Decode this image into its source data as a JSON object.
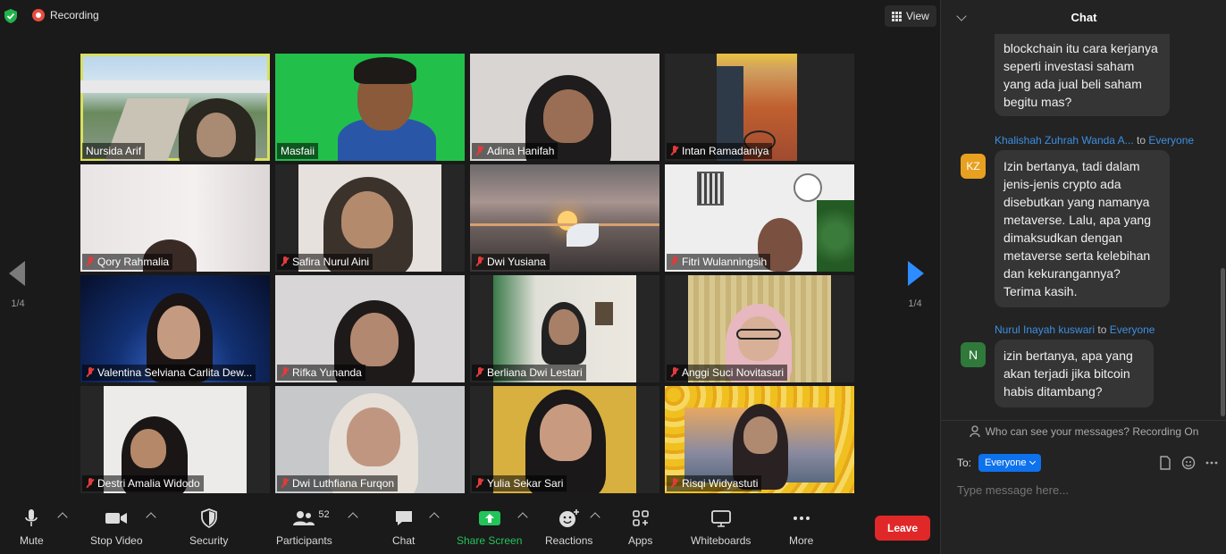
{
  "topbar": {
    "recording_label": "Recording",
    "view_label": "View"
  },
  "pagination": {
    "left": "1/4",
    "right": "1/4"
  },
  "participants_grid": [
    {
      "name": "Nursida Arif",
      "muted": false,
      "active": true
    },
    {
      "name": "Masfaii",
      "muted": false,
      "active": false
    },
    {
      "name": "Adina Hanifah",
      "muted": true,
      "active": false
    },
    {
      "name": "Intan Ramadaniya",
      "muted": true,
      "active": false
    },
    {
      "name": "Qory Rahmalia",
      "muted": true,
      "active": false
    },
    {
      "name": "Safira Nurul Aini",
      "muted": true,
      "active": false
    },
    {
      "name": "Dwi Yusiana",
      "muted": true,
      "active": false
    },
    {
      "name": "Fitri Wulanningsih",
      "muted": true,
      "active": false
    },
    {
      "name": "Valentina Selviana Carlita Dew...",
      "muted": true,
      "active": false
    },
    {
      "name": "Rifka Yunanda",
      "muted": true,
      "active": false
    },
    {
      "name": "Berliana Dwi Lestari",
      "muted": true,
      "active": false
    },
    {
      "name": "Anggi Suci Novitasari",
      "muted": true,
      "active": false
    },
    {
      "name": "Destri Amalia Widodo",
      "muted": true,
      "active": false
    },
    {
      "name": "Dwi Luthfiana Furqon",
      "muted": true,
      "active": false
    },
    {
      "name": "Yulia Sekar Sari",
      "muted": true,
      "active": false
    },
    {
      "name": "Risqi Widyastuti",
      "muted": true,
      "active": false
    }
  ],
  "toolbar": {
    "mute": "Mute",
    "stop_video": "Stop Video",
    "security": "Security",
    "participants": "Participants",
    "participants_count": "52",
    "chat": "Chat",
    "share_screen": "Share Screen",
    "reactions": "Reactions",
    "apps": "Apps",
    "whiteboards": "Whiteboards",
    "more": "More",
    "leave": "Leave"
  },
  "chat": {
    "title": "Chat",
    "messages": [
      {
        "text": "blockchain itu cara kerjanya seperti investasi saham yang ada jual beli saham begitu mas?"
      },
      {
        "sender": "Khalishah Zuhrah Wanda A...",
        "to_word": "to",
        "recipient": "Everyone",
        "initials": "KZ",
        "text": "Izin bertanya, tadi dalam jenis-jenis crypto ada disebutkan yang namanya metaverse. Lalu, apa yang dimaksudkan dengan metaverse serta kelebihan dan kekurangannya? Terima kasih."
      },
      {
        "sender": "Nurul Inayah kuswari",
        "to_word": "to",
        "recipient": "Everyone",
        "initials": "N",
        "text": "izin bertanya, apa yang akan terjadi jika bitcoin habis ditambang?"
      }
    ],
    "privacy_note": "Who can see your messages? Recording On",
    "to_label": "To:",
    "to_value": "Everyone",
    "input_placeholder": "Type message here..."
  },
  "colors": {
    "accent": "#2d8cff",
    "leave": "#e02828",
    "active_speaker": "#d8e060",
    "share": "#23c45a"
  }
}
